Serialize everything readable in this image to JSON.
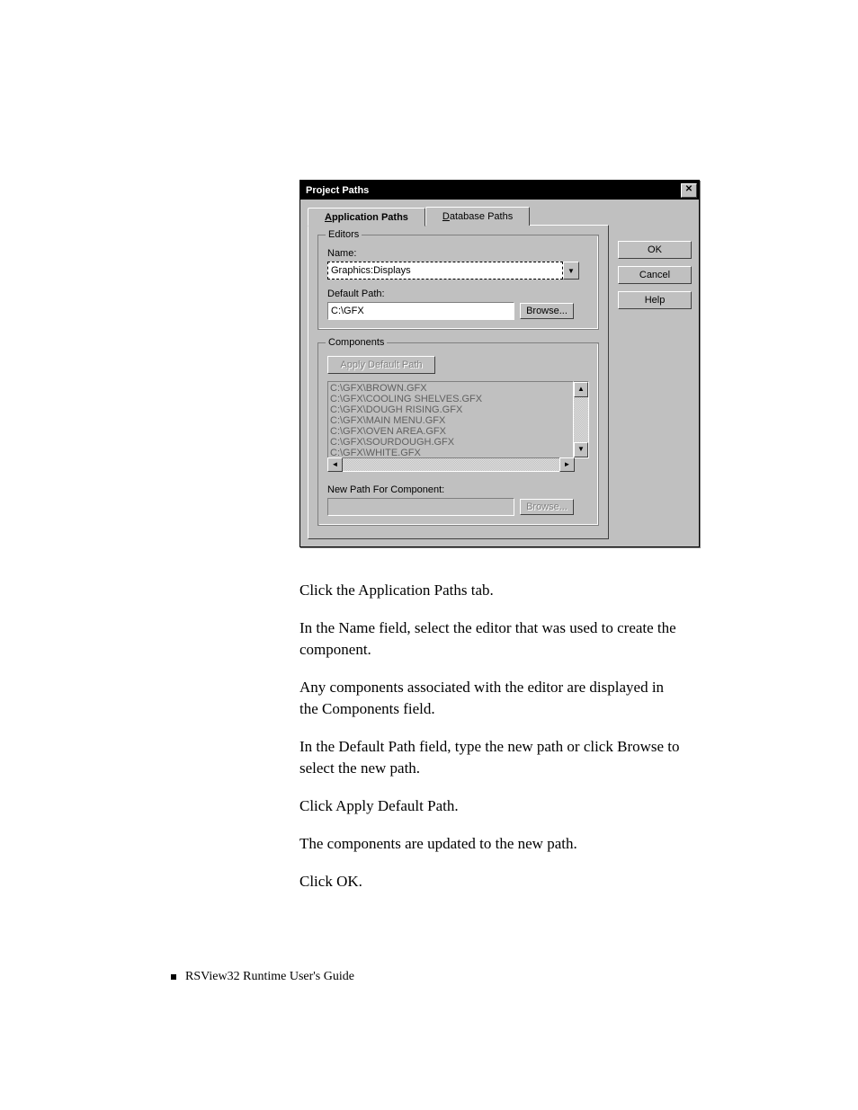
{
  "dialog": {
    "title": "Project Paths",
    "tabs": {
      "app": "Application Paths",
      "db": "Database Paths"
    },
    "editors": {
      "group": "Editors",
      "name_label": "Name:",
      "name_value": "Graphics:Displays",
      "default_path_label": "Default Path:",
      "default_path_value": "C:\\GFX",
      "browse": "Browse..."
    },
    "components": {
      "group": "Components",
      "apply_btn": "Apply Default Path",
      "items": [
        "C:\\GFX\\BROWN.GFX",
        "C:\\GFX\\COOLING SHELVES.GFX",
        "C:\\GFX\\DOUGH RISING.GFX",
        "C:\\GFX\\MAIN MENU.GFX",
        "C:\\GFX\\OVEN AREA.GFX",
        "C:\\GFX\\SOURDOUGH.GFX",
        "C:\\GFX\\WHITE.GFX"
      ],
      "new_path_label": "New Path For Component:",
      "new_path_value": "",
      "browse": "Browse..."
    },
    "buttons": {
      "ok": "OK",
      "cancel": "Cancel",
      "help": "Help"
    }
  },
  "doc": {
    "p1": "Click the Application Paths tab.",
    "p2": "In the Name field, select the editor that was used to create the component.",
    "p3": "Any components associated with the editor are displayed in the Components field.",
    "p4": "In the Default Path field, type the new path or click Browse to select the new path.",
    "p5": "Click Apply Default Path.",
    "p6": "The components are updated to the new path.",
    "p7": "Click OK."
  },
  "footer": "RSView32  Runtime User's Guide"
}
